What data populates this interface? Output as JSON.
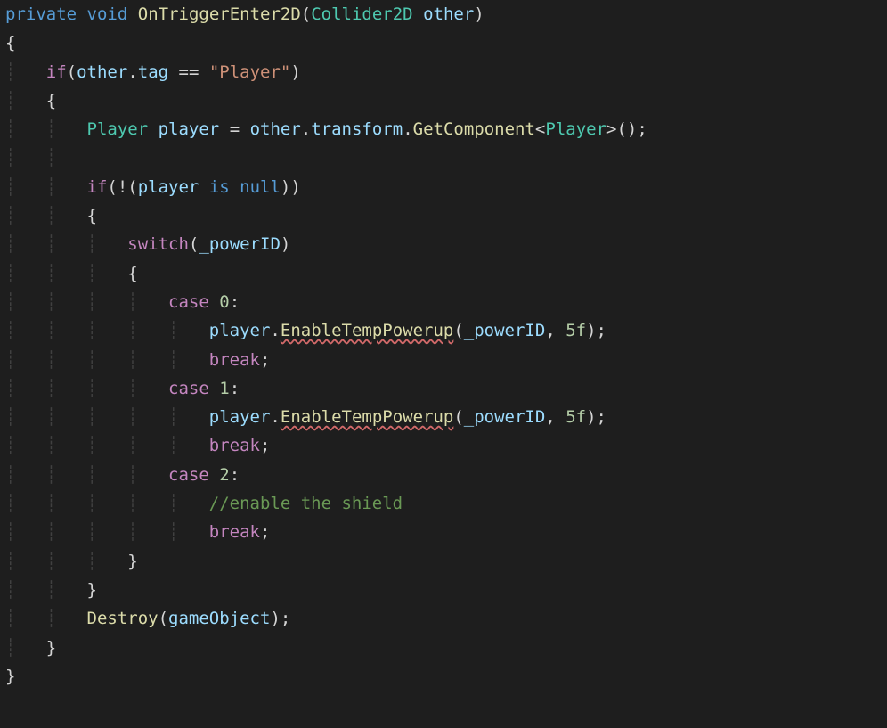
{
  "code": {
    "line1": {
      "kw_private": "private",
      "kw_void": "void",
      "method": "OnTriggerEnter2D",
      "paren_open": "(",
      "type": "Collider2D",
      "param": "other",
      "paren_close": ")"
    },
    "line2": {
      "brace": "{"
    },
    "line3": {
      "kw_if": "if",
      "open": "(",
      "var": "other",
      "dot": ".",
      "prop": "tag",
      "eq": " == ",
      "str": "\"Player\"",
      "close": ")"
    },
    "line4": {
      "brace": "{"
    },
    "line5": {
      "type1": "Player",
      "var": "player",
      "eq": " = ",
      "other": "other",
      "dot1": ".",
      "transform": "transform",
      "dot2": ".",
      "method": "GetComponent",
      "lt": "<",
      "type2": "Player",
      "gt": ">();"
    },
    "line7": {
      "kw_if": "if",
      "open": "(!(",
      "var": "player",
      "is": " is ",
      "null": "null",
      "close": "))"
    },
    "line8": {
      "brace": "{"
    },
    "line9": {
      "kw_switch": "switch",
      "open": "(",
      "var": "_powerID",
      "close": ")"
    },
    "line10": {
      "brace": "{"
    },
    "line11": {
      "kw_case": "case",
      "num": "0",
      "colon": ":"
    },
    "line12": {
      "var": "player",
      "dot": ".",
      "method": "EnableTempPowerup",
      "open": "(",
      "arg1": "_powerID",
      "comma": ", ",
      "arg2": "5f",
      "close": ");"
    },
    "line13": {
      "kw_break": "break",
      "semi": ";"
    },
    "line14": {
      "kw_case": "case",
      "num": "1",
      "colon": ":"
    },
    "line15": {
      "var": "player",
      "dot": ".",
      "method": "EnableTempPowerup",
      "open": "(",
      "arg1": "_powerID",
      "comma": ", ",
      "arg2": "5f",
      "close": ");"
    },
    "line16": {
      "kw_break": "break",
      "semi": ";"
    },
    "line17": {
      "kw_case": "case",
      "num": "2",
      "colon": ":"
    },
    "line18": {
      "comment": "//enable the shield"
    },
    "line19": {
      "kw_break": "break",
      "semi": ";"
    },
    "line20": {
      "brace": "}"
    },
    "line21": {
      "brace": "}"
    },
    "line22": {
      "method": "Destroy",
      "open": "(",
      "arg": "gameObject",
      "close": ");"
    },
    "line23": {
      "brace": "}"
    },
    "line24": {
      "brace": "}"
    }
  }
}
